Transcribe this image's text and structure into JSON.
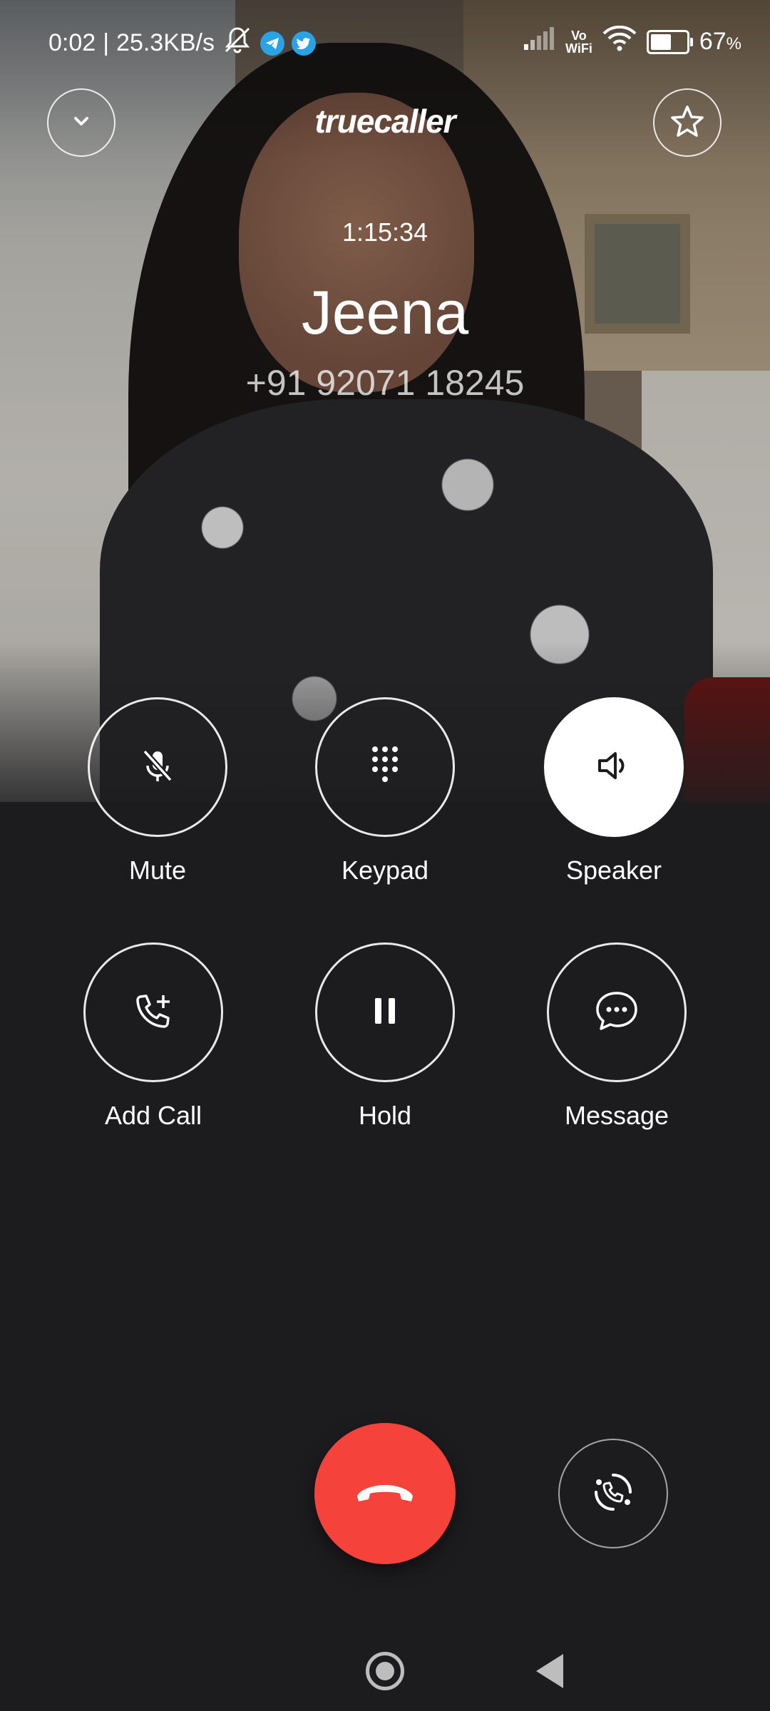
{
  "status_bar": {
    "time": "0:02",
    "speed": "25.3KB/s",
    "separator": "|",
    "vowifi_top": "Vo",
    "vowifi_bottom": "WiFi",
    "battery": "67",
    "battery_unit": "%",
    "battery_level": 0.67,
    "icons": [
      "silent-bell-icon",
      "telegram-icon",
      "twitter-icon",
      "signal-icon",
      "vowifi-icon",
      "wifi-icon",
      "battery-icon"
    ]
  },
  "header": {
    "logo": "truecaller",
    "collapse_icon": "chevron-down-icon",
    "favorite_icon": "star-icon"
  },
  "call": {
    "duration": "1:15:34",
    "name": "Jeena",
    "number": "+91 92071 18245"
  },
  "controls": [
    {
      "label": "Mute",
      "icon": "mic-off-icon",
      "active": false
    },
    {
      "label": "Keypad",
      "icon": "keypad-icon",
      "active": false
    },
    {
      "label": "Speaker",
      "icon": "speaker-icon",
      "active": true
    },
    {
      "label": "Add Call",
      "icon": "add-call-icon",
      "active": false
    },
    {
      "label": "Hold",
      "icon": "pause-icon",
      "active": false
    },
    {
      "label": "Message",
      "icon": "message-icon",
      "active": false
    }
  ],
  "actions": {
    "end_call_icon": "end-call-icon",
    "end_call_color": "#f5433b",
    "switch_icon": "swap-call-icon"
  },
  "nav": {
    "home_icon": "home-icon",
    "back_icon": "back-icon"
  }
}
